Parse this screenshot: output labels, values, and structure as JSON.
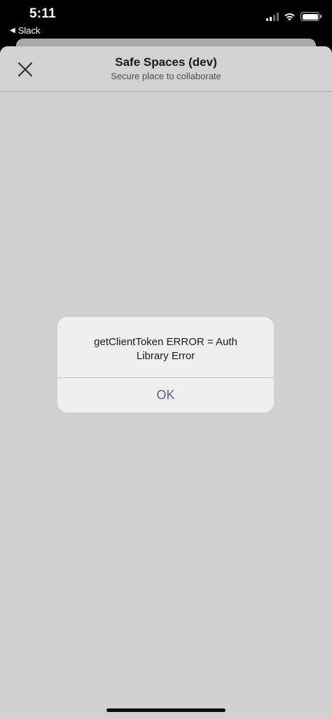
{
  "status_bar": {
    "time": "5:11",
    "back_app_label": "Slack",
    "back_icon": "back-triangle-icon",
    "signal_icon": "cellular-signal-icon",
    "wifi_icon": "wifi-icon",
    "battery_icon": "battery-icon"
  },
  "sheet": {
    "title": "Safe Spaces (dev)",
    "subtitle": "Secure place to collaborate",
    "close_icon": "close-icon",
    "background_color": "#d0d0d0"
  },
  "alert": {
    "message": "getClientToken ERROR = Auth Library Error",
    "ok_label": "OK",
    "button_color": "#5b5f97"
  }
}
